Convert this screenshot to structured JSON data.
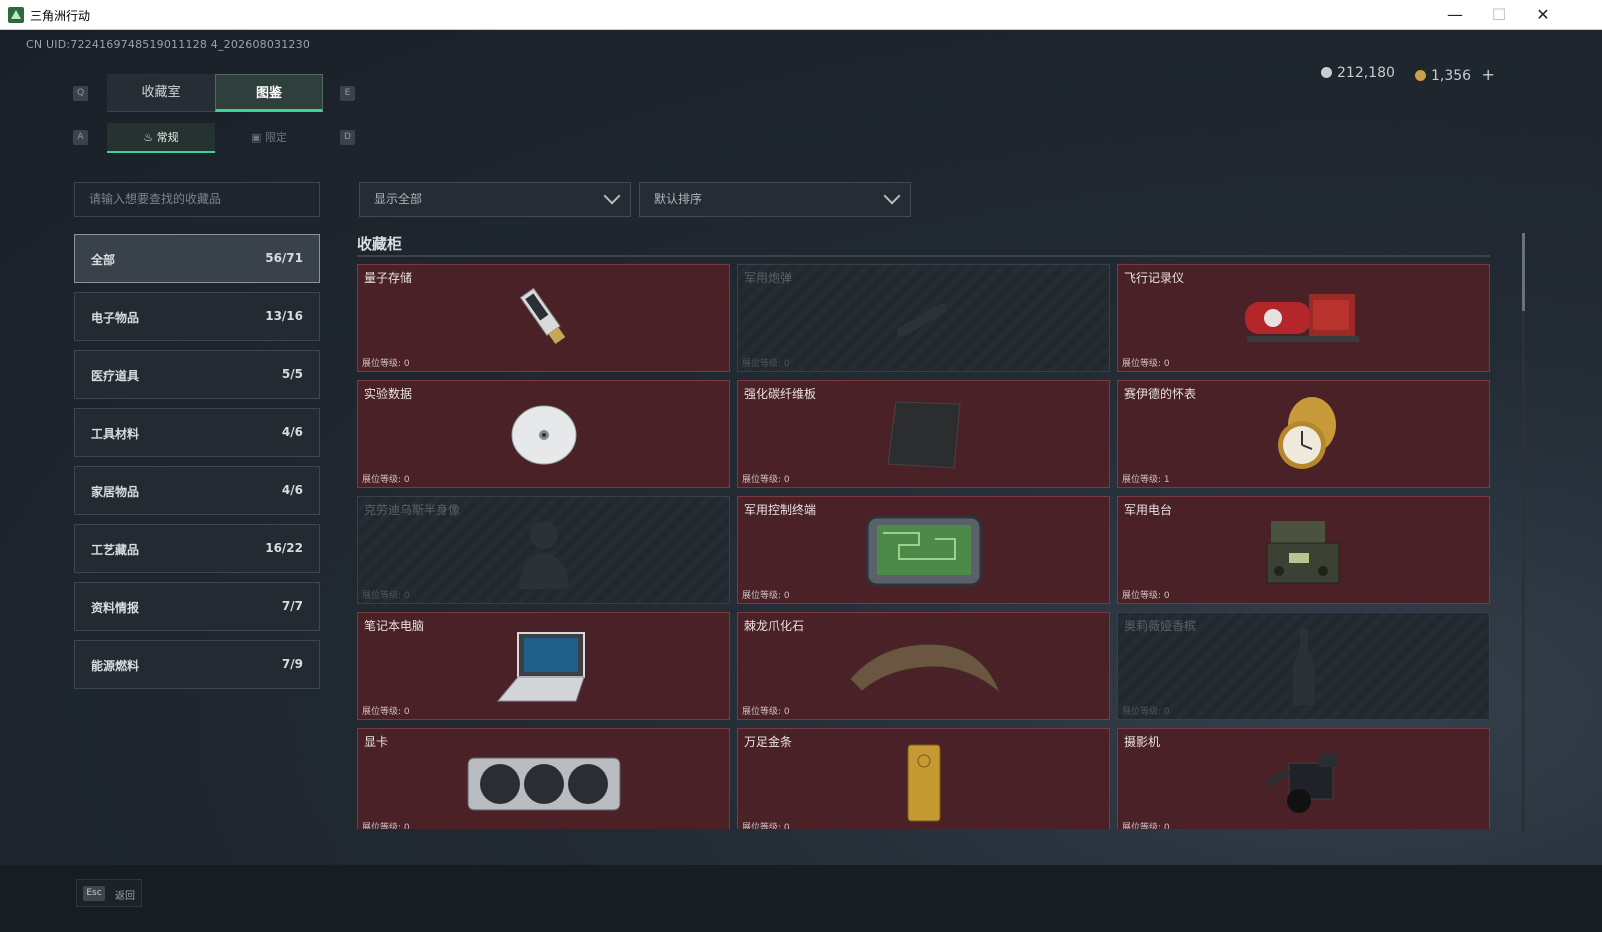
{
  "window": {
    "title": "三角洲行动",
    "minimize": "—",
    "maximize": "☐",
    "close": "✕"
  },
  "header": {
    "uid": "CN UID:7224169748519011128 4_202608031230",
    "currency": [
      {
        "value": "212,180",
        "color": "#c9ccd0"
      },
      {
        "value": "1,356",
        "color": "#c8a24a"
      }
    ],
    "add": "+"
  },
  "tabs": {
    "key_left": "Q",
    "key_right": "E",
    "items": [
      {
        "label": "收藏室"
      },
      {
        "label": "图鉴"
      }
    ]
  },
  "subtabs": {
    "key_left": "A",
    "key_right": "D",
    "items": [
      {
        "label": "常规"
      },
      {
        "label": "限定"
      }
    ]
  },
  "search": {
    "placeholder": "请输入想要查找的收藏品"
  },
  "filters": {
    "show": "显示全部",
    "sort": "默认排序"
  },
  "categories": [
    {
      "label": "全部",
      "count": "56/71"
    },
    {
      "label": "电子物品",
      "count": "13/16"
    },
    {
      "label": "医疗道具",
      "count": "5/5"
    },
    {
      "label": "工具材料",
      "count": "4/6"
    },
    {
      "label": "家居物品",
      "count": "4/6"
    },
    {
      "label": "工艺藏品",
      "count": "16/22"
    },
    {
      "label": "资料情报",
      "count": "7/7"
    },
    {
      "label": "能源燃料",
      "count": "7/9"
    }
  ],
  "section": {
    "title": "收藏柜",
    "level_label": "展位等级"
  },
  "items": [
    {
      "name": "量子存储",
      "level": "展位等级: 0",
      "icon": "usb-drive-icon"
    },
    {
      "name": "军用炮弹",
      "level": "展位等级: 0",
      "icon": "shell-icon"
    },
    {
      "name": "飞行记录仪",
      "level": "展位等级: 0",
      "icon": "flight-recorder-icon"
    },
    {
      "name": "实验数据",
      "level": "展位等级: 0",
      "icon": "disc-icon"
    },
    {
      "name": "强化碳纤维板",
      "level": "展位等级: 0",
      "icon": "carbon-plate-icon"
    },
    {
      "name": "赛伊德的怀表",
      "level": "展位等级: 1",
      "icon": "pocket-watch-icon"
    },
    {
      "name": "克劳迪乌斯半身像",
      "level": "展位等级: 0",
      "icon": "bust-icon"
    },
    {
      "name": "军用控制终端",
      "level": "展位等级: 0",
      "icon": "control-terminal-icon"
    },
    {
      "name": "军用电台",
      "level": "展位等级: 0",
      "icon": "radio-icon"
    },
    {
      "name": "笔记本电脑",
      "level": "展位等级: 0",
      "icon": "laptop-icon"
    },
    {
      "name": "棘龙爪化石",
      "level": "展位等级: 0",
      "icon": "claw-fossil-icon"
    },
    {
      "name": "奥莉薇娅香槟",
      "level": "展位等级: 0",
      "icon": "champagne-icon"
    },
    {
      "name": "显卡",
      "level": "展位等级: 0",
      "icon": "graphics-card-icon"
    },
    {
      "name": "万足金条",
      "level": "展位等级: 0",
      "icon": "gold-bar-icon"
    },
    {
      "name": "摄影机",
      "level": "展位等级: 0",
      "icon": "camera-icon"
    }
  ],
  "footer": {
    "key": "Esc",
    "label": "返回"
  }
}
